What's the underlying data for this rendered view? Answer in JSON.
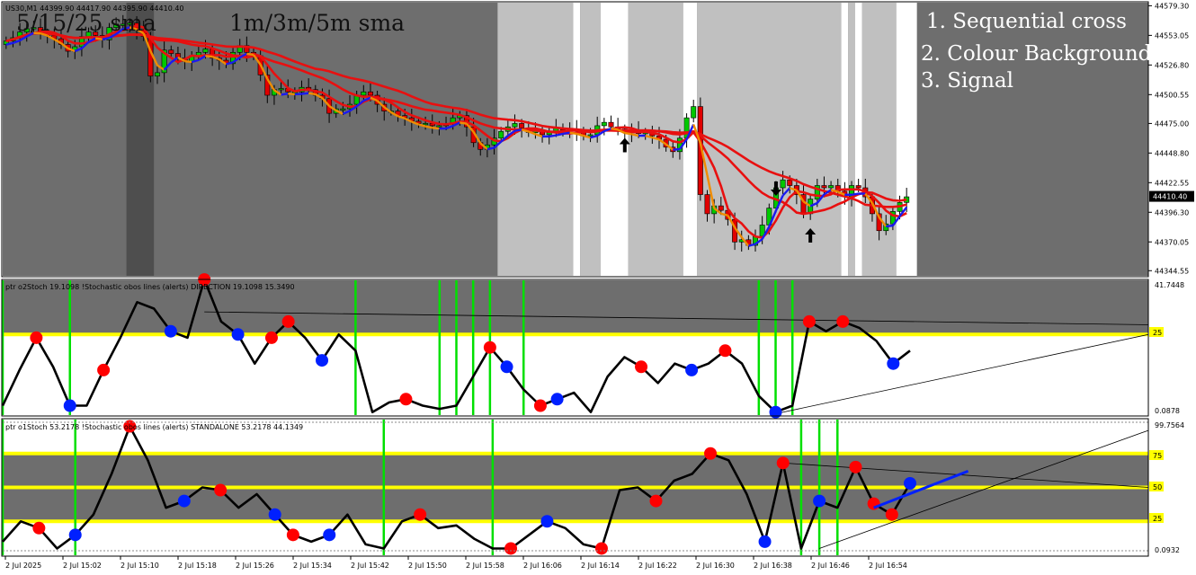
{
  "colors": {
    "bg_dark": "#6e6e6e",
    "bg_darker": "#4e4e4e",
    "bg_light": "#c0c0c0",
    "bg_white": "#ffffff",
    "bull_candle": "#00c800",
    "bear_candle": "#e00000",
    "sma": "#e81010",
    "fast_up": "#1a1af0",
    "fast_dn": "#f08c00",
    "level_line": "#ffff00",
    "cross_line": "#00e000",
    "stoch_line": "#000000",
    "dot_red": "#ff0000",
    "dot_blue": "#0020ff"
  },
  "main": {
    "symbol_info": "US30,M1 44399.90 44417.90 44395.90 44410.40",
    "title_left": "5/15/25 sma",
    "title_right": "1m/3m/5m sma",
    "list": [
      "1. Sequential cross",
      "2. Colour Background",
      "3. Signal"
    ],
    "price_ticks": [
      "44579.30",
      "44553.05",
      "44526.80",
      "44500.55",
      "44475.00",
      "44448.80",
      "44422.55",
      "44396.30",
      "44370.05",
      "44344.55"
    ],
    "last_price": "44410.40"
  },
  "sub1": {
    "header": "ptr o2Stoch 19.1098 !Stochastic obos lines (alerts) DIRECTION 19.1098 15.3490",
    "axis_top": "41.7448",
    "axis_level": "25",
    "axis_bottom": "0.0878"
  },
  "sub2": {
    "header": "ptr o1Stoch 53.2178 !Stochastic obos lines (alerts) STANDALONE 53.2178 44.1349",
    "axis_top": "99.7564",
    "axis_levels": [
      "75",
      "50",
      "25"
    ],
    "axis_bottom": "0.0932"
  },
  "time_ticks": [
    "2 Jul 2025",
    "2 Jul 15:02",
    "2 Jul 15:10",
    "2 Jul 15:18",
    "2 Jul 15:26",
    "2 Jul 15:34",
    "2 Jul 15:42",
    "2 Jul 15:50",
    "2 Jul 15:58",
    "2 Jul 16:06",
    "2 Jul 16:14",
    "2 Jul 16:22",
    "2 Jul 16:30",
    "2 Jul 16:38",
    "2 Jul 16:46",
    "2 Jul 16:54"
  ],
  "chart_data": [
    {
      "type": "candlestick",
      "title": "5/15/25 sma",
      "symbol": "US30,M1",
      "ylim": [
        44340,
        44582
      ],
      "price_tick_values": [
        44579.3,
        44553.05,
        44526.8,
        44500.55,
        44475.0,
        44448.8,
        44422.55,
        44396.3,
        44370.05,
        44344.55
      ],
      "close": [
        44548,
        44551,
        44556,
        44559,
        44560,
        44555,
        44553,
        44550,
        44545,
        44539,
        44543,
        44552,
        44556,
        44553,
        44549,
        44560,
        44563,
        44563,
        44564,
        44558,
        44552,
        44517,
        44520,
        44540,
        44537,
        44533,
        44530,
        44535,
        44538,
        44541,
        44533,
        44531,
        44528,
        44538,
        44544,
        44538,
        44535,
        44518,
        44500,
        44505,
        44506,
        44503,
        44503,
        44507,
        44505,
        44500,
        44497,
        44484,
        44488,
        44488,
        44492,
        44500,
        44503,
        44500,
        44492,
        44486,
        44486,
        44482,
        44480,
        44477,
        44475,
        44475,
        44473,
        44473,
        44475,
        44480,
        44482,
        44472,
        44458,
        44452,
        44456,
        44462,
        44468,
        44472,
        44475,
        44471,
        44467,
        44468,
        44465,
        44467,
        44471,
        44469,
        44470,
        44468,
        44464,
        44465,
        44473,
        44476,
        44472,
        44470,
        44467,
        44469,
        44466,
        44467,
        44464,
        44461,
        44454,
        44450,
        44462,
        44480,
        44490,
        44412,
        44395,
        44402,
        44398,
        44390,
        44370,
        44372,
        44367,
        44375,
        44385,
        44400,
        44418,
        44425,
        44420,
        44412,
        44395,
        44408,
        44420,
        44418,
        44420,
        44415,
        44410,
        44420,
        44418,
        44410,
        44395,
        44380,
        44386,
        44397,
        44405,
        44410
      ],
      "sma_series": [
        {
          "period": 5,
          "values_note": "tracks close"
        },
        {
          "period": 15
        },
        {
          "period": 25
        }
      ],
      "background_segments": [
        {
          "from": 0,
          "to": 72,
          "shade": "dark"
        },
        {
          "from": 72,
          "to": 83,
          "shade": "light"
        },
        {
          "from": 83,
          "to": 84,
          "shade": "white"
        },
        {
          "from": 84,
          "to": 87,
          "shade": "light"
        },
        {
          "from": 87,
          "to": 91,
          "shade": "white"
        },
        {
          "from": 91,
          "to": 99,
          "shade": "light"
        },
        {
          "from": 99,
          "to": 101,
          "shade": "white"
        },
        {
          "from": 101,
          "to": 122,
          "shade": "light"
        },
        {
          "from": 122,
          "to": 123,
          "shade": "white"
        },
        {
          "from": 123,
          "to": 124,
          "shade": "light"
        },
        {
          "from": 124,
          "to": 125,
          "shade": "white"
        },
        {
          "from": 125,
          "to": 130,
          "shade": "light"
        },
        {
          "from": 130,
          "to": 133,
          "shade": "white"
        }
      ],
      "signals": [
        {
          "index": 90,
          "dir": "up",
          "price": 44455
        },
        {
          "index": 112,
          "dir": "down",
          "price": 44418
        },
        {
          "index": 117,
          "dir": "up",
          "price": 44375
        }
      ]
    },
    {
      "type": "line",
      "title": "ptr o2Stoch",
      "ylim": [
        0.0878,
        41.7448
      ],
      "level": 25,
      "values": [
        3,
        14,
        24,
        15,
        3,
        3,
        14,
        24,
        35,
        33,
        26,
        24,
        42,
        29,
        25,
        16,
        24,
        29,
        24,
        17,
        25,
        20,
        1,
        4,
        5,
        3,
        2,
        3,
        12,
        21,
        15,
        8,
        3,
        5,
        7,
        1,
        12,
        18,
        15,
        10,
        16,
        14,
        16,
        20,
        16,
        6,
        1,
        3,
        29,
        26,
        29,
        27,
        23,
        16,
        20
      ]
    },
    {
      "type": "line",
      "title": "ptr o1Stoch",
      "ylim": [
        0,
        100
      ],
      "levels": [
        75,
        50,
        25
      ],
      "values": [
        10,
        25,
        20,
        5,
        15,
        30,
        60,
        95,
        70,
        35,
        40,
        50,
        48,
        35,
        45,
        30,
        15,
        10,
        15,
        30,
        8,
        5,
        25,
        30,
        20,
        22,
        12,
        5,
        5,
        15,
        25,
        20,
        8,
        5,
        48,
        50,
        40,
        55,
        60,
        75,
        70,
        45,
        10,
        68,
        5,
        40,
        35,
        65,
        38,
        30,
        53
      ]
    }
  ]
}
